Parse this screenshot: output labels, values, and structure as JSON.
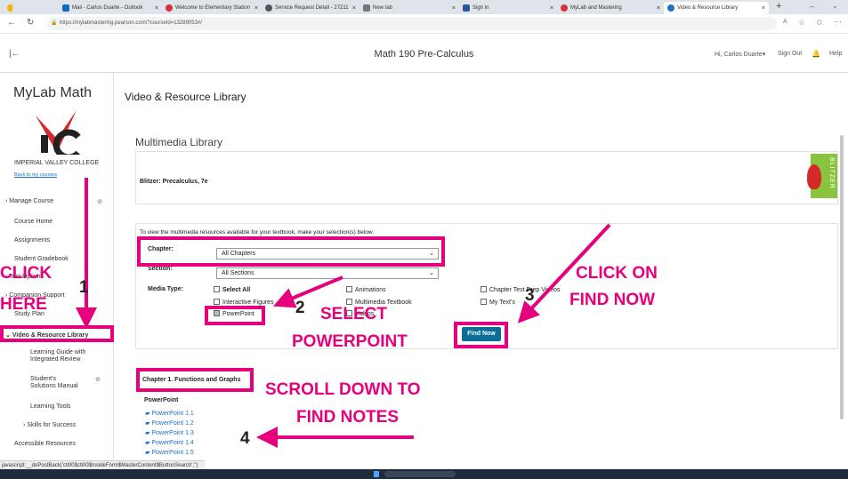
{
  "browser": {
    "tabs": [
      {
        "label": "Mail - Carlos Duarte - Outlook",
        "color": "#0f6cbd"
      },
      {
        "label": "Welcome to Elementary Station",
        "color": "#d13438"
      },
      {
        "label": "Service Request Detail - 27211",
        "color": "#555555"
      },
      {
        "label": "New tab",
        "color": "#555555"
      },
      {
        "label": "Sign in",
        "color": "#2b579a"
      },
      {
        "label": "MyLab and Mastering",
        "color": "#d13438"
      },
      {
        "label": "Video & Resource Library",
        "color": "#1a73c8"
      }
    ],
    "url": "https://mylabmastering.pearson.com/?courseId=13289053#/"
  },
  "header": {
    "course_title": "Math 190 Pre-Calculus",
    "user": "Hi, Carlos Duarte",
    "sign_out": "Sign Out",
    "help": "Help"
  },
  "sidebar": {
    "brand": "MyLab Math",
    "college": "IMPERIAL VALLEY COLLEGE",
    "back_link": "Back to my courses",
    "items": [
      {
        "label": "Manage Course"
      },
      {
        "label": "Course Home"
      },
      {
        "label": "Assignments"
      },
      {
        "label": "Student Gradebook"
      },
      {
        "label": "Test Options"
      },
      {
        "label": "Companion Support"
      },
      {
        "label": "Study Plan"
      },
      {
        "label": "Video & Resource Library"
      },
      {
        "label": "Learning Guide with Integrated Review"
      },
      {
        "label": "Student's Solutions Manual"
      },
      {
        "label": "Learning Tools"
      },
      {
        "label": "Skills for Success"
      },
      {
        "label": "Accessible Resources"
      }
    ]
  },
  "main": {
    "page_title": "Video & Resource Library",
    "section_title": "Multimedia Library",
    "book_title": "Blitzer: Precalculus, 7e",
    "book_cover_text": "BLITZER",
    "instruction": "To view the multimedia resources available for your textbook, make your selection(s) below.",
    "chapter_label": "Chapter:",
    "chapter_value": "All Chapters",
    "section_label": "Section:",
    "section_value": "All Sections",
    "media_type_label": "Media Type:",
    "media_options": {
      "select_all": "Select All",
      "interactive_figures": "Interactive Figures",
      "powerpoint": "PowerPoint",
      "animations": "Animations",
      "multimedia_textbook": "Multimedia Textbook",
      "videos": "Videos",
      "chapter_test_prep": "Chapter Test Prep Videos",
      "my_texts": "My Text's"
    },
    "find_now": "Find Now",
    "result_chapter": "Chapter 1. Functions and Graphs",
    "result_type": "PowerPoint",
    "results": [
      "PowerPoint 1.1",
      "PowerPoint 1.2",
      "PowerPoint 1.3",
      "PowerPoint 1.4",
      "PowerPoint 1.5"
    ]
  },
  "annotations": {
    "click_here": [
      "CLICK",
      "HERE"
    ],
    "step1": "1",
    "step2": "2",
    "step3": "3",
    "step4": "4",
    "select": "SELECT",
    "powerpoint": "POWERPOINT",
    "click_on": "CLICK ON",
    "find_now": "FIND NOW",
    "scroll_down": "SCROLL DOWN TO",
    "find_notes": "FIND NOTES",
    "accent": "#e6007e"
  },
  "status_bar": "javascript:__doPostBack('ctl00$ctl00$InsideForm$MasterContent$ButtonSearch','')"
}
